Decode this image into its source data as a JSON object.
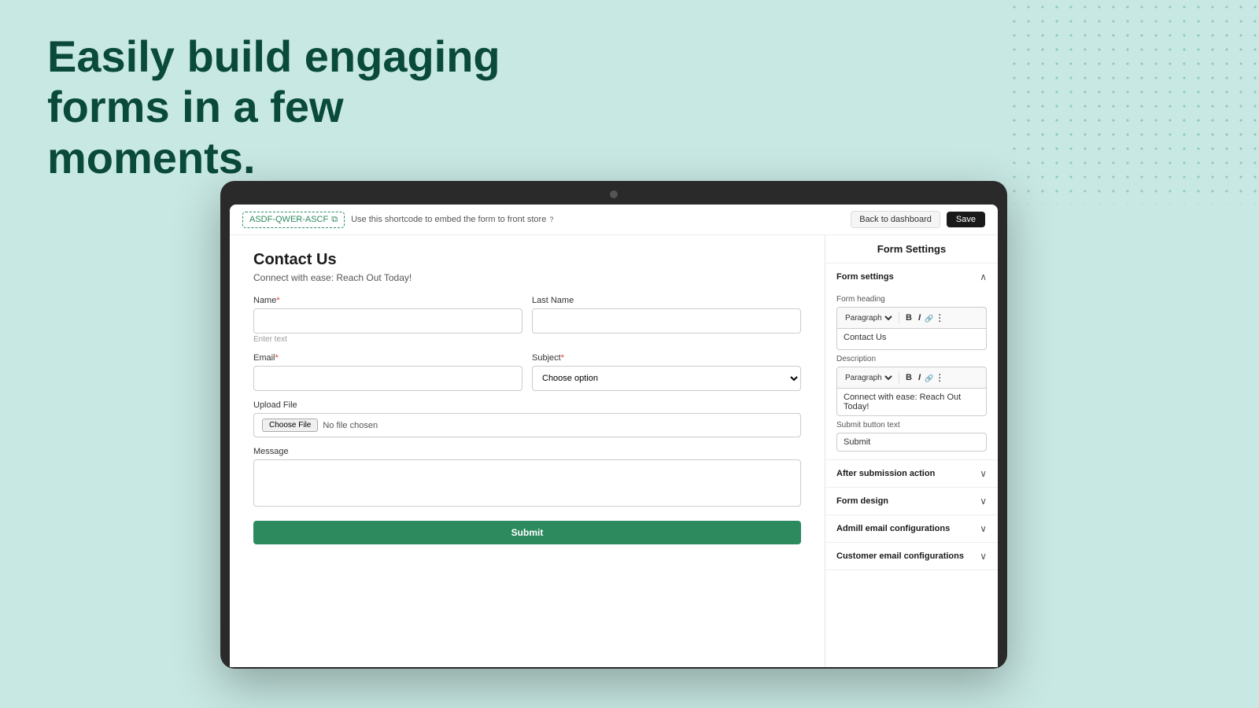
{
  "hero": {
    "line1": "Easily build engaging forms in a few",
    "line2": "moments."
  },
  "topbar": {
    "shortcode": "ASDF-QWER-ASCF",
    "hint_text": "Use this shortcode to embed the form to front store",
    "back_label": "Back to dashboard",
    "save_label": "Save"
  },
  "form": {
    "title": "Contact Us",
    "description": "Connect with ease: Reach Out Today!",
    "fields": {
      "name_label": "Name",
      "name_required": "*",
      "name_hint": "Enter text",
      "lastname_label": "Last Name",
      "email_label": "Email",
      "email_required": "*",
      "subject_label": "Subject",
      "subject_required": "*",
      "subject_placeholder": "Choose option",
      "upload_label": "Upload File",
      "choose_file_btn": "Choose File",
      "no_file_text": "No file chosen",
      "message_label": "Message"
    },
    "submit_label": "Submit"
  },
  "sidebar": {
    "title": "Form Settings",
    "sections": [
      {
        "id": "form-settings",
        "title": "Form settings",
        "expanded": true,
        "fields": [
          {
            "label": "Form heading",
            "toolbar_options": [
              "Paragraph"
            ],
            "content": "Contact Us"
          },
          {
            "label": "Description",
            "toolbar_options": [
              "Paragraph"
            ],
            "content": "Connect with ease: Reach Out Today!"
          },
          {
            "label": "Submit button text",
            "value": "Submit"
          }
        ]
      },
      {
        "id": "after-submission",
        "title": "After submission action",
        "expanded": false
      },
      {
        "id": "form-design",
        "title": "Form design",
        "expanded": false
      },
      {
        "id": "admin-email",
        "title": "Admill email configurations",
        "expanded": false
      },
      {
        "id": "customer-email",
        "title": "Customer email configurations",
        "expanded": false
      }
    ]
  }
}
